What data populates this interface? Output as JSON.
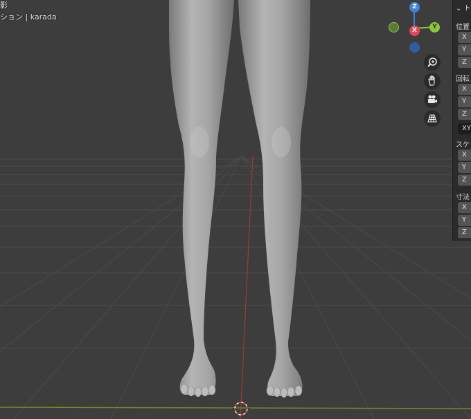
{
  "viewport": {
    "mode_label": "透視投影",
    "mode_label_visible": "影",
    "collection_label": "ション | karada",
    "background_color": "#3d3d3d",
    "grid_color": "#4a4a4a",
    "x_axis_color": "#9c3a3a",
    "y_axis_color": "#6b8e23"
  },
  "gizmo": {
    "z_label": "Z",
    "x_label": "X",
    "y_label": "Y",
    "colors": {
      "x": "#e6465a",
      "y": "#8cc43a",
      "z": "#3e84d6",
      "neg_x": "#5a7a3a",
      "neg_z": "#2f5e9e"
    }
  },
  "nav_buttons": [
    {
      "icon": "zoom-in-icon"
    },
    {
      "icon": "hand-pan-icon"
    },
    {
      "icon": "camera-icon"
    },
    {
      "icon": "grid-perspective-icon"
    }
  ],
  "n_panel": {
    "collapse_glyph": "⌄",
    "tab_label_fragment": "ト",
    "sections": [
      {
        "label": "位置",
        "fields": [
          "X",
          "Y",
          "Z"
        ]
      },
      {
        "label": "回転",
        "fields": [
          "X",
          "Y",
          "Z"
        ],
        "mode": "XYZ"
      },
      {
        "label": "スケ",
        "fields": [
          "X",
          "Y",
          "Z"
        ]
      },
      {
        "label": "寸法",
        "fields": [
          "X",
          "Y",
          "Z"
        ]
      }
    ]
  },
  "origin_marker": "3d-cursor"
}
